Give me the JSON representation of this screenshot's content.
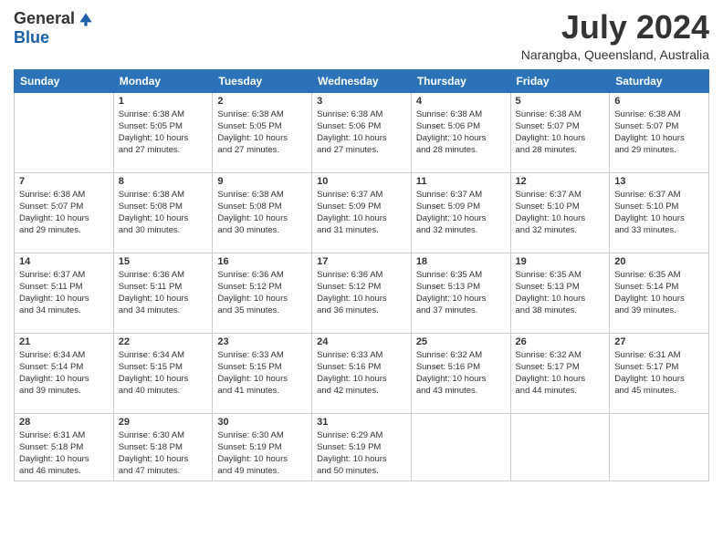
{
  "header": {
    "logo": {
      "general": "General",
      "blue": "Blue"
    },
    "title": "July 2024",
    "location": "Narangba, Queensland, Australia"
  },
  "days_of_week": [
    "Sunday",
    "Monday",
    "Tuesday",
    "Wednesday",
    "Thursday",
    "Friday",
    "Saturday"
  ],
  "weeks": [
    [
      {
        "day": "",
        "info": ""
      },
      {
        "day": "1",
        "info": "Sunrise: 6:38 AM\nSunset: 5:05 PM\nDaylight: 10 hours\nand 27 minutes."
      },
      {
        "day": "2",
        "info": "Sunrise: 6:38 AM\nSunset: 5:05 PM\nDaylight: 10 hours\nand 27 minutes."
      },
      {
        "day": "3",
        "info": "Sunrise: 6:38 AM\nSunset: 5:06 PM\nDaylight: 10 hours\nand 27 minutes."
      },
      {
        "day": "4",
        "info": "Sunrise: 6:38 AM\nSunset: 5:06 PM\nDaylight: 10 hours\nand 28 minutes."
      },
      {
        "day": "5",
        "info": "Sunrise: 6:38 AM\nSunset: 5:07 PM\nDaylight: 10 hours\nand 28 minutes."
      },
      {
        "day": "6",
        "info": "Sunrise: 6:38 AM\nSunset: 5:07 PM\nDaylight: 10 hours\nand 29 minutes."
      }
    ],
    [
      {
        "day": "7",
        "info": "Sunrise: 6:38 AM\nSunset: 5:07 PM\nDaylight: 10 hours\nand 29 minutes."
      },
      {
        "day": "8",
        "info": "Sunrise: 6:38 AM\nSunset: 5:08 PM\nDaylight: 10 hours\nand 30 minutes."
      },
      {
        "day": "9",
        "info": "Sunrise: 6:38 AM\nSunset: 5:08 PM\nDaylight: 10 hours\nand 30 minutes."
      },
      {
        "day": "10",
        "info": "Sunrise: 6:37 AM\nSunset: 5:09 PM\nDaylight: 10 hours\nand 31 minutes."
      },
      {
        "day": "11",
        "info": "Sunrise: 6:37 AM\nSunset: 5:09 PM\nDaylight: 10 hours\nand 32 minutes."
      },
      {
        "day": "12",
        "info": "Sunrise: 6:37 AM\nSunset: 5:10 PM\nDaylight: 10 hours\nand 32 minutes."
      },
      {
        "day": "13",
        "info": "Sunrise: 6:37 AM\nSunset: 5:10 PM\nDaylight: 10 hours\nand 33 minutes."
      }
    ],
    [
      {
        "day": "14",
        "info": "Sunrise: 6:37 AM\nSunset: 5:11 PM\nDaylight: 10 hours\nand 34 minutes."
      },
      {
        "day": "15",
        "info": "Sunrise: 6:36 AM\nSunset: 5:11 PM\nDaylight: 10 hours\nand 34 minutes."
      },
      {
        "day": "16",
        "info": "Sunrise: 6:36 AM\nSunset: 5:12 PM\nDaylight: 10 hours\nand 35 minutes."
      },
      {
        "day": "17",
        "info": "Sunrise: 6:36 AM\nSunset: 5:12 PM\nDaylight: 10 hours\nand 36 minutes."
      },
      {
        "day": "18",
        "info": "Sunrise: 6:35 AM\nSunset: 5:13 PM\nDaylight: 10 hours\nand 37 minutes."
      },
      {
        "day": "19",
        "info": "Sunrise: 6:35 AM\nSunset: 5:13 PM\nDaylight: 10 hours\nand 38 minutes."
      },
      {
        "day": "20",
        "info": "Sunrise: 6:35 AM\nSunset: 5:14 PM\nDaylight: 10 hours\nand 39 minutes."
      }
    ],
    [
      {
        "day": "21",
        "info": "Sunrise: 6:34 AM\nSunset: 5:14 PM\nDaylight: 10 hours\nand 39 minutes."
      },
      {
        "day": "22",
        "info": "Sunrise: 6:34 AM\nSunset: 5:15 PM\nDaylight: 10 hours\nand 40 minutes."
      },
      {
        "day": "23",
        "info": "Sunrise: 6:33 AM\nSunset: 5:15 PM\nDaylight: 10 hours\nand 41 minutes."
      },
      {
        "day": "24",
        "info": "Sunrise: 6:33 AM\nSunset: 5:16 PM\nDaylight: 10 hours\nand 42 minutes."
      },
      {
        "day": "25",
        "info": "Sunrise: 6:32 AM\nSunset: 5:16 PM\nDaylight: 10 hours\nand 43 minutes."
      },
      {
        "day": "26",
        "info": "Sunrise: 6:32 AM\nSunset: 5:17 PM\nDaylight: 10 hours\nand 44 minutes."
      },
      {
        "day": "27",
        "info": "Sunrise: 6:31 AM\nSunset: 5:17 PM\nDaylight: 10 hours\nand 45 minutes."
      }
    ],
    [
      {
        "day": "28",
        "info": "Sunrise: 6:31 AM\nSunset: 5:18 PM\nDaylight: 10 hours\nand 46 minutes."
      },
      {
        "day": "29",
        "info": "Sunrise: 6:30 AM\nSunset: 5:18 PM\nDaylight: 10 hours\nand 47 minutes."
      },
      {
        "day": "30",
        "info": "Sunrise: 6:30 AM\nSunset: 5:19 PM\nDaylight: 10 hours\nand 49 minutes."
      },
      {
        "day": "31",
        "info": "Sunrise: 6:29 AM\nSunset: 5:19 PM\nDaylight: 10 hours\nand 50 minutes."
      },
      {
        "day": "",
        "info": ""
      },
      {
        "day": "",
        "info": ""
      },
      {
        "day": "",
        "info": ""
      }
    ]
  ]
}
